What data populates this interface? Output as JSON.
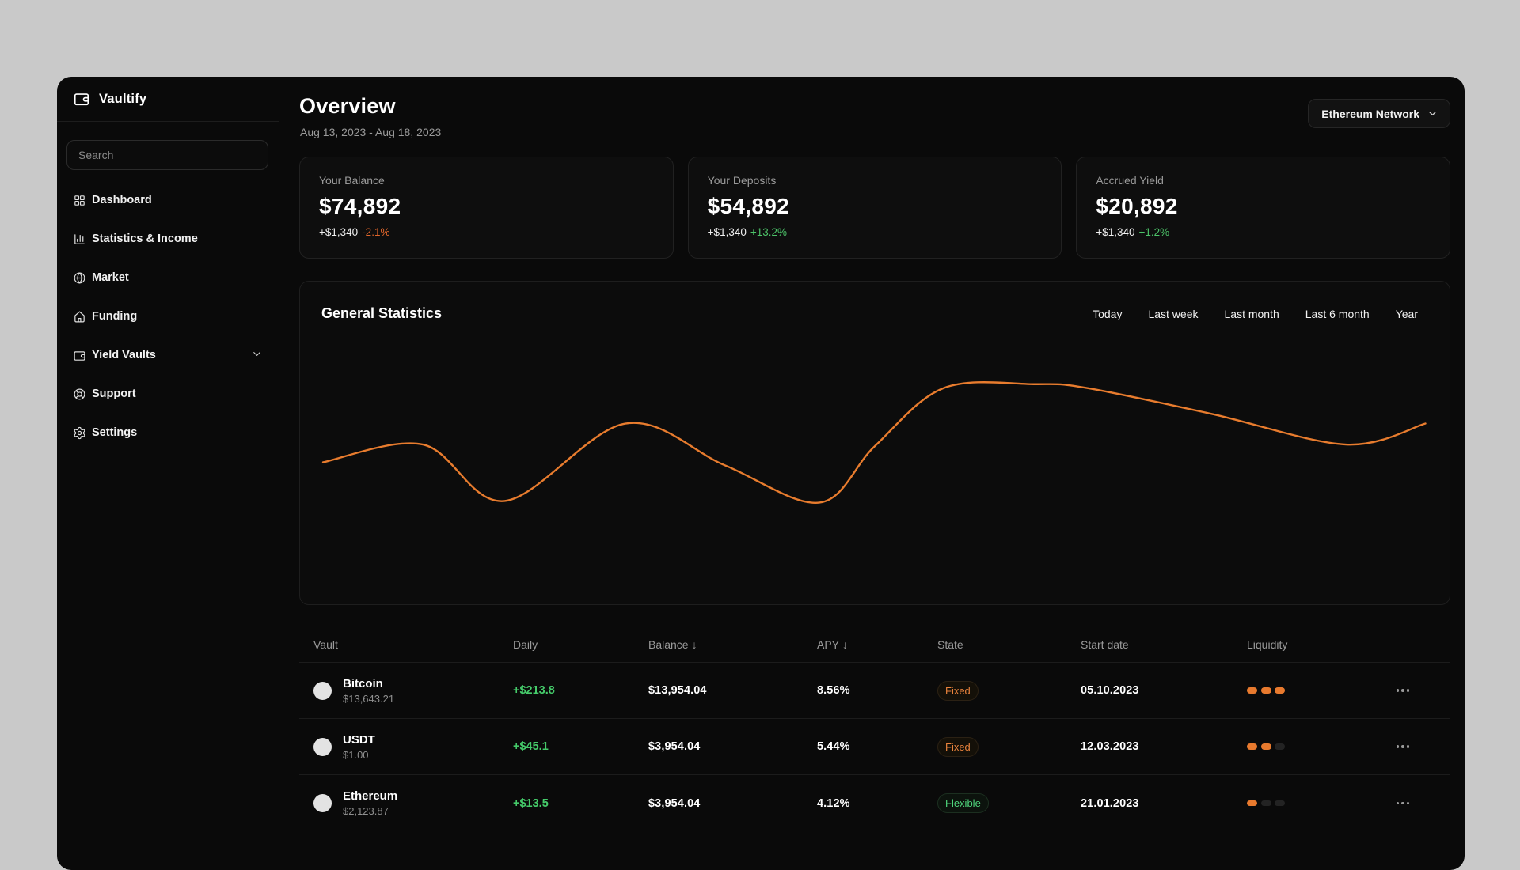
{
  "app": {
    "name": "Vaultify"
  },
  "sidebar": {
    "search_placeholder": "Search",
    "items": [
      {
        "label": "Dashboard",
        "icon": "dashboard"
      },
      {
        "label": "Statistics & Income",
        "icon": "bar-chart"
      },
      {
        "label": "Market",
        "icon": "globe"
      },
      {
        "label": "Funding",
        "icon": "home"
      },
      {
        "label": "Yield Vaults",
        "icon": "wallet",
        "expandable": true
      },
      {
        "label": "Support",
        "icon": "life-buoy"
      },
      {
        "label": "Settings",
        "icon": "gear"
      }
    ]
  },
  "header": {
    "title": "Overview",
    "date_range": "Aug 13, 2023 - Aug 18, 2023",
    "network_selector": "Ethereum Network"
  },
  "stats_cards": [
    {
      "label": "Your Balance",
      "value": "$74,892",
      "delta": "+$1,340",
      "delta_pct": "-2.1%",
      "delta_pct_color": "#e0662b"
    },
    {
      "label": "Your Deposits",
      "value": "$54,892",
      "delta": "+$1,340",
      "delta_pct": "+13.2%",
      "delta_pct_color": "#4cc268"
    },
    {
      "label": "Accrued Yield",
      "value": "$20,892",
      "delta": "+$1,340",
      "delta_pct": "+1.2%",
      "delta_pct_color": "#4cc268"
    }
  ],
  "chart": {
    "title": "General Statistics",
    "ranges": [
      "Today",
      "Last week",
      "Last month",
      "Last 6 month",
      "Year"
    ],
    "line_color": "#e87c2e"
  },
  "chart_data": {
    "type": "line",
    "title": "General Statistics",
    "x_pct": [
      2,
      10.7,
      17.8,
      28.3,
      37,
      45.2,
      50,
      56,
      64,
      68.5,
      79.3,
      91,
      97.9
    ],
    "values_pct": [
      44,
      49.5,
      32,
      56,
      43,
      31.5,
      49,
      67,
      68.2,
      67,
      59,
      49.5,
      56
    ],
    "xlabel": "",
    "ylabel": "",
    "grid": false,
    "legend": false
  },
  "table": {
    "columns": [
      {
        "label": "Vault"
      },
      {
        "label": "Daily"
      },
      {
        "label": "Balance",
        "sort_icon": "↓"
      },
      {
        "label": "APY",
        "sort_icon": "↓"
      },
      {
        "label": "State"
      },
      {
        "label": "Start date"
      },
      {
        "label": "Liquidity"
      }
    ],
    "rows": [
      {
        "name": "Bitcoin",
        "price": "$13,643.21",
        "daily": "+$213.8",
        "balance": "$13,954.04",
        "apy": "8.56%",
        "state": "Fixed",
        "start_date": "05.10.2023",
        "liquidity": 3
      },
      {
        "name": "USDT",
        "price": "$1.00",
        "daily": "+$45.1",
        "balance": "$3,954.04",
        "apy": "5.44%",
        "state": "Fixed",
        "start_date": "12.03.2023",
        "liquidity": 2
      },
      {
        "name": "Ethereum",
        "price": "$2,123.87",
        "daily": "+$13.5",
        "balance": "$3,954.04",
        "apy": "4.12%",
        "state": "Flexible",
        "start_date": "21.01.2023",
        "liquidity": 1
      }
    ]
  }
}
